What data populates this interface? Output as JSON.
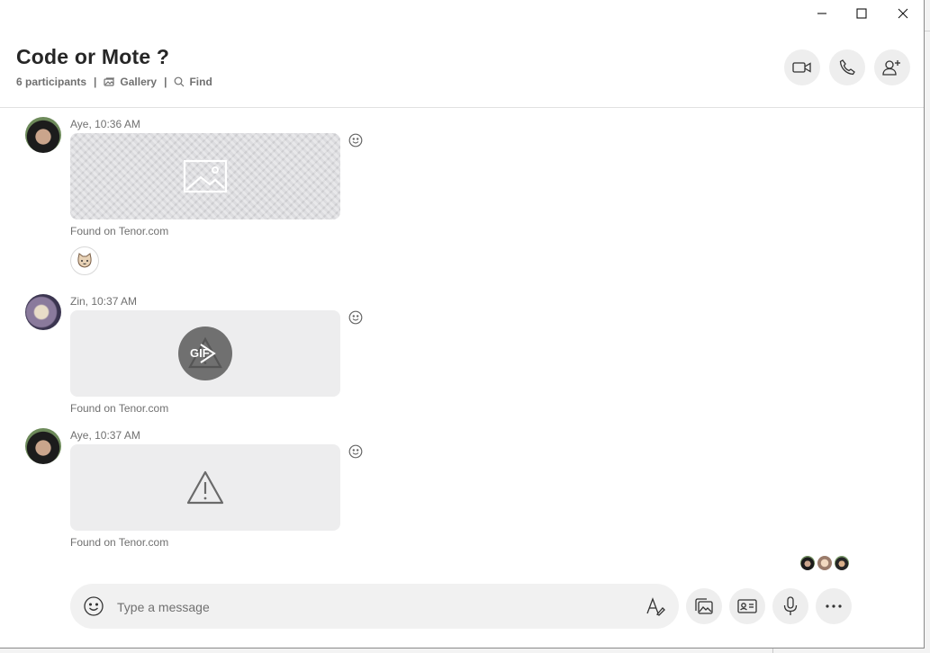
{
  "window": {
    "controls": [
      "minimize",
      "maximize",
      "close"
    ]
  },
  "header": {
    "title": "Code or Mote ?",
    "participants": "6 participants",
    "gallery_label": "Gallery",
    "find_label": "Find",
    "separator": "|",
    "buttons": [
      "video-call",
      "audio-call",
      "add-people"
    ]
  },
  "messages": [
    {
      "sender": "Aye",
      "time": "10:36 AM",
      "meta": "Aye, 10:36 AM",
      "media_type": "image-placeholder",
      "caption": "Found on Tenor.com",
      "reaction": "cat-face"
    },
    {
      "sender": "Zin",
      "time": "10:37 AM",
      "meta": "Zin, 10:37 AM",
      "media_type": "gif",
      "gif_label": "GIF",
      "caption": "Found on Tenor.com"
    },
    {
      "sender": "Aye",
      "time": "10:37 AM",
      "meta": "Aye, 10:37 AM",
      "media_type": "warning-placeholder",
      "caption": "Found on Tenor.com"
    }
  ],
  "read_receipts_count": 3,
  "composer": {
    "placeholder": "Type a message"
  },
  "colors": {
    "accent_text": "#262626",
    "muted_text": "#707070",
    "button_bg": "#eeeeee",
    "composer_bg": "#f1f1f1"
  }
}
